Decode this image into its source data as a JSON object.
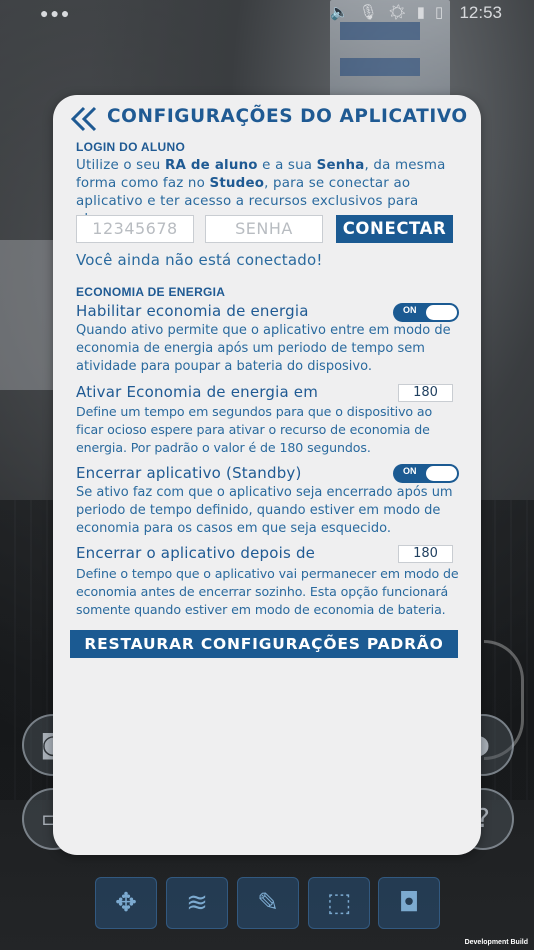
{
  "status_bar": {
    "menu_dots": "●●●",
    "icons": [
      "speaker-icon",
      "mic-icon",
      "brightness-icon",
      "signal-icon",
      "battery-icon"
    ],
    "time": "12:53"
  },
  "panel": {
    "title": "CONFIGURAÇÕES DO APLICATIVO",
    "login": {
      "section_title": "LOGIN DO ALUNO",
      "intro_parts": [
        "Utilize o seu ",
        "RA de aluno",
        " e a sua ",
        "Senha",
        ", da mesma forma como faz no ",
        "Studeo",
        ", para se conectar ao aplicativo e ter acesso a recursos exclusivos para alunos."
      ],
      "ra_placeholder": "12345678",
      "password_placeholder": "SENHA",
      "connect_label": "CONECTAR",
      "connection_status": "Você ainda não está conectado!"
    },
    "energy": {
      "section_title": "ECONOMIA DE ENERGIA",
      "settings": [
        {
          "label": "Habilitar economia de energia",
          "control": "toggle",
          "value": "ON",
          "description": "Quando ativo permite que o aplicativo entre em modo de economia de energia após um periodo de tempo sem atividade para poupar a bateria do disposivo."
        },
        {
          "label": "Ativar Economia de energia em",
          "control": "number",
          "value": "180",
          "description": "Define um tempo em segundos para que o dispositivo ao ficar ocioso espere para ativar o recurso de economia de energia. Por padrão o valor é de 180 segundos."
        },
        {
          "label": "Encerrar aplicativo (Standby)",
          "control": "toggle",
          "value": "ON",
          "description": "Se ativo faz com que o aplicativo seja encerrado após um periodo de tempo definido, quando estiver em modo de economia para os casos em que seja esquecido."
        },
        {
          "label": "Encerrar o aplicativo depois de",
          "control": "number",
          "value": "180",
          "description": "Define o tempo que o aplicativo vai permanecer em modo de economia antes de encerrar sozinho. Esta opção funcionará somente quando estiver em modo de economia de bateria."
        }
      ]
    },
    "restore_label": "RESTAURAR CONFIGURAÇÕES PADRÃO"
  },
  "background_controls": {
    "side_buttons": [
      "camera-icon",
      "speaker-icon",
      "monitor-icon",
      "help-icon"
    ],
    "toolbar": [
      "move-icon",
      "layers-icon",
      "brush-icon",
      "box-icon",
      "vr-headset-icon"
    ]
  },
  "dev_build_label": "Development Build",
  "colors": {
    "accent": "#1b5a92",
    "title": "#1f5a93",
    "text": "#2a6a9e",
    "panel_bg": "#efeff0"
  }
}
